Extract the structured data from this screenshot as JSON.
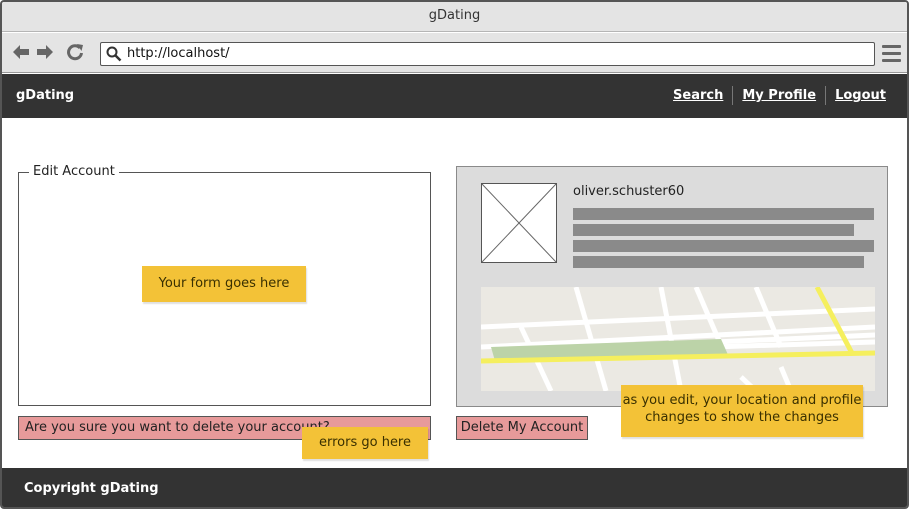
{
  "window": {
    "title": "gDating",
    "url": "http://localhost/"
  },
  "header": {
    "brand": "gDating",
    "nav": [
      {
        "label": "Search"
      },
      {
        "label": "My Profile"
      },
      {
        "label": "Logout"
      }
    ]
  },
  "edit_account": {
    "legend": "Edit Account",
    "form_note": "Your form goes here",
    "delete_confirm": "Are you sure you want to delete your account?",
    "errors_note": "errors go here"
  },
  "profile": {
    "username": "oliver.schuster60",
    "delete_button": "Delete My Account",
    "map_note_line1": "as you edit, your location and profile",
    "map_note_line2": "changes to show the changes"
  },
  "footer": {
    "copyright": "Copyright gDating"
  },
  "icons": {
    "back": "arrow-left-icon",
    "forward": "arrow-right-icon",
    "reload": "reload-icon",
    "search": "search-icon",
    "menu": "hamburger-menu-icon",
    "avatar_placeholder": "image-placeholder-icon"
  },
  "colors": {
    "header_bg": "#333333",
    "sticky_note": "#f3c237",
    "alert_bg": "#e79a9a",
    "card_bg": "#dcdcdc",
    "placeholder_bar": "#8a8a8a"
  }
}
